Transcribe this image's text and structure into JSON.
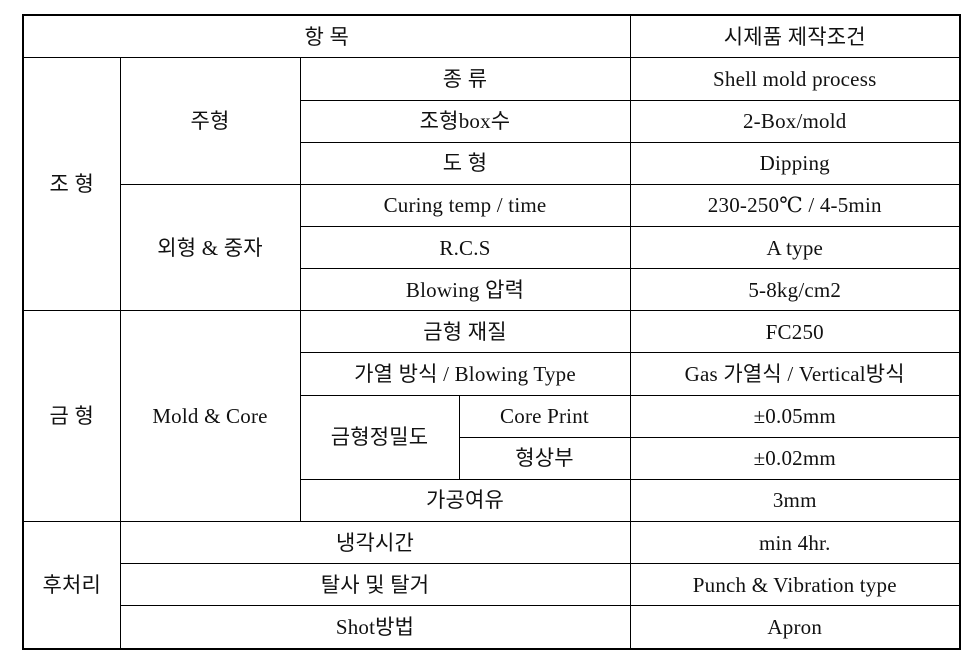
{
  "table": {
    "header": {
      "item_label": "항    목",
      "condition_label": "시제품 제작조건"
    },
    "sections": [
      {
        "name": "조 형",
        "groups": [
          {
            "name": "주형",
            "rows": [
              {
                "item": "종    류",
                "value": "Shell mold process"
              },
              {
                "item": "조형box수",
                "value": "2-Box/mold"
              },
              {
                "item": "도    형",
                "value": "Dipping"
              }
            ]
          },
          {
            "name": "외형 & 중자",
            "rows": [
              {
                "item": "Curing temp / time",
                "value": "230-250℃ / 4-5min"
              },
              {
                "item": "R.C.S",
                "value": "A type"
              },
              {
                "item": "Blowing 압력",
                "value": "5-8kg/cm2"
              }
            ]
          }
        ]
      },
      {
        "name": "금 형",
        "groups": [
          {
            "name": "Mold & Core",
            "rows": [
              {
                "item": "금형 재질",
                "value": "FC250"
              },
              {
                "item": "가열 방식 / Blowing Type",
                "value": "Gas 가열식 / Vertical방식"
              },
              {
                "item": "금형정밀도",
                "sub": "Core Print",
                "value": "±0.05mm"
              },
              {
                "sub": "형상부",
                "value": "±0.02mm"
              },
              {
                "item": "가공여유",
                "value": "3mm"
              }
            ]
          }
        ]
      },
      {
        "name": "후처리",
        "groups": [
          {
            "name": "",
            "rows": [
              {
                "item": "냉각시간",
                "value": "min 4hr."
              },
              {
                "item": "탈사 및 탈거",
                "value": "Punch & Vibration type"
              },
              {
                "item": "Shot방법",
                "value": "Apron"
              }
            ]
          }
        ]
      }
    ]
  }
}
